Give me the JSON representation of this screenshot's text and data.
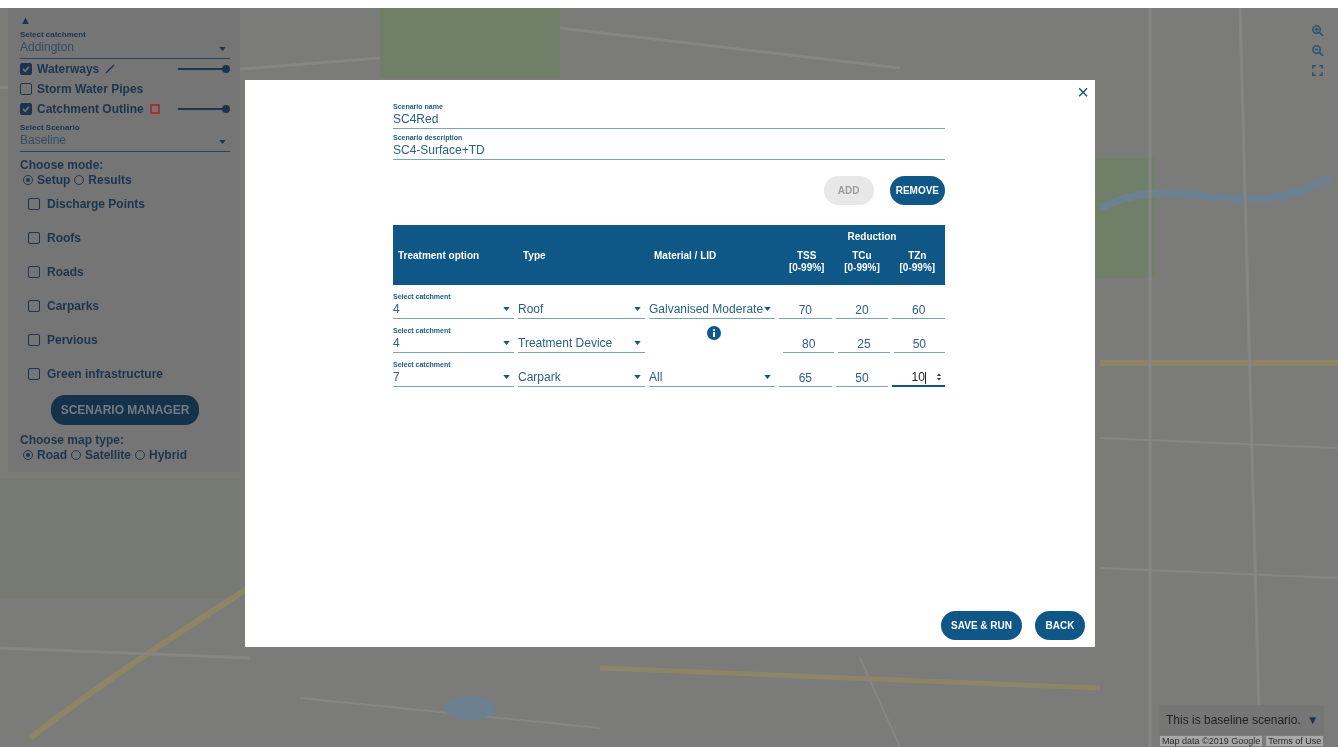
{
  "sidebar": {
    "toggle": "▲",
    "catchment": {
      "label": "Select catchment",
      "value": "Addington"
    },
    "layers": [
      {
        "label": "Waterways",
        "checked": true,
        "kind": "line",
        "level": 1
      },
      {
        "label": "Storm Water Pipes",
        "checked": false,
        "kind": "plain"
      },
      {
        "label": "Catchment Outline",
        "checked": true,
        "kind": "square",
        "level": 1
      }
    ],
    "scenario": {
      "label": "Select Scenario",
      "value": "Baseline"
    },
    "mode": {
      "title": "Choose mode:",
      "options": [
        {
          "label": "Setup",
          "selected": true
        },
        {
          "label": "Results",
          "selected": false
        }
      ]
    },
    "features": [
      {
        "label": "Discharge Points",
        "checked": false
      },
      {
        "label": "Roofs",
        "checked": false
      },
      {
        "label": "Roads",
        "checked": false
      },
      {
        "label": "Carparks",
        "checked": false
      },
      {
        "label": "Pervious",
        "checked": false
      },
      {
        "label": "Green infrastructure",
        "checked": false
      }
    ],
    "manager_button": "SCENARIO MANAGER",
    "map_type": {
      "title": "Choose map type:",
      "options": [
        {
          "label": "Road",
          "selected": true
        },
        {
          "label": "Satellite",
          "selected": false
        },
        {
          "label": "Hybrid",
          "selected": false
        }
      ]
    }
  },
  "dialog": {
    "close": "×",
    "name": {
      "label": "Scenario name",
      "value": "SC4Red"
    },
    "description": {
      "label": "Scenario description",
      "value": "SC4-Surface+TD"
    },
    "actions": [
      {
        "label": "ADD",
        "disabled": true
      },
      {
        "label": "REMOVE",
        "disabled": false
      }
    ],
    "table": {
      "columns": [
        "Treatment option",
        "Type",
        "Material / LID"
      ],
      "group": "Reduction",
      "reduction_columns": [
        {
          "name": "TSS",
          "range": "[0-99%]"
        },
        {
          "name": "TCu",
          "range": "[0-99%]"
        },
        {
          "name": "TZn",
          "range": "[0-99%]"
        }
      ],
      "rows": [
        {
          "catchment_label": "Select catchment",
          "catchment": "4",
          "type": "Roof",
          "kind": "select",
          "material": "Galvanised Moderate",
          "reductions": [
            {
              "value": "70",
              "focused": false
            },
            {
              "value": "20",
              "focused": false
            },
            {
              "value": "60",
              "focused": false
            }
          ]
        },
        {
          "catchment_label": "Select catchment",
          "catchment": "4",
          "type": "Treatment Device",
          "kind": "info",
          "reductions": [
            {
              "value": "80",
              "focused": false
            },
            {
              "value": "25",
              "focused": false
            },
            {
              "value": "50",
              "focused": false
            }
          ]
        },
        {
          "catchment_label": "Select catchment",
          "catchment": "7",
          "type": "Carpark",
          "kind": "select",
          "material": "All",
          "reductions": [
            {
              "value": "65",
              "focused": false
            },
            {
              "value": "50",
              "focused": false
            },
            {
              "value": "10",
              "focused": true
            }
          ]
        }
      ]
    },
    "footer": [
      "SAVE & RUN",
      "BACK"
    ]
  },
  "scenario_note": {
    "text": "This is baseline scenario.",
    "toggle": "▼"
  },
  "attribution": {
    "map_data": "Map data ©2019 Google",
    "terms": "Terms of Use"
  }
}
